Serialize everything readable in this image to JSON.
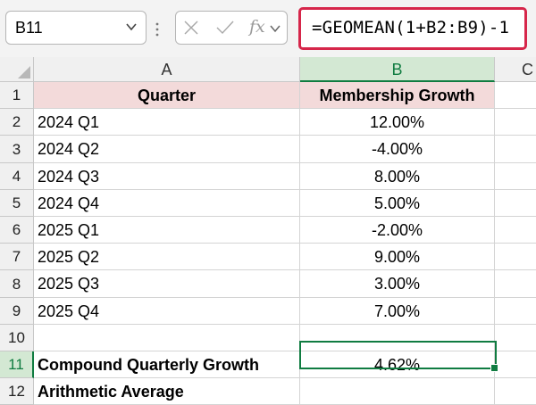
{
  "formula_bar": {
    "name_box": "B11",
    "fx_label": "fx",
    "formula": "=GEOMEAN(1+B2:B9)-1"
  },
  "columns": [
    "A",
    "B",
    "C"
  ],
  "rows": [
    {
      "num": "1",
      "a": "Quarter",
      "b": "Membership Growth"
    },
    {
      "num": "2",
      "a": "2024 Q1",
      "b": "12.00%"
    },
    {
      "num": "3",
      "a": "2024 Q2",
      "b": "-4.00%"
    },
    {
      "num": "4",
      "a": "2024 Q3",
      "b": "8.00%"
    },
    {
      "num": "5",
      "a": "2024 Q4",
      "b": "5.00%"
    },
    {
      "num": "6",
      "a": "2025 Q1",
      "b": "-2.00%"
    },
    {
      "num": "7",
      "a": "2025 Q2",
      "b": "9.00%"
    },
    {
      "num": "8",
      "a": "2025 Q3",
      "b": "3.00%"
    },
    {
      "num": "9",
      "a": "2025 Q4",
      "b": "7.00%"
    },
    {
      "num": "10",
      "a": "",
      "b": ""
    },
    {
      "num": "11",
      "a": "Compound Quarterly Growth",
      "b": "4.62%"
    },
    {
      "num": "12",
      "a": "Arithmetic Average",
      "b": ""
    }
  ],
  "colors": {
    "accent_green": "#107c41",
    "formula_border": "#d6264a",
    "header_fill": "#f3dada"
  }
}
